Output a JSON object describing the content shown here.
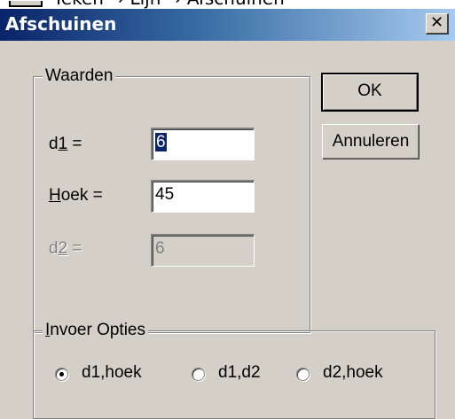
{
  "background_strip": {
    "text": "Teken → Lijn → Afschuinen"
  },
  "window": {
    "title": "Afschuinen",
    "close_glyph": "✕"
  },
  "waarden": {
    "legend": "Waarden",
    "d1": {
      "label_pre": "d",
      "label_mnemonic": "1",
      "label_post": " =",
      "value": "6"
    },
    "hoek": {
      "label_mnemonic": "H",
      "label_post": "oek =",
      "value": "45"
    },
    "d2": {
      "label_pre": "d",
      "label_mnemonic": "2",
      "label_post": " =",
      "value": "6"
    }
  },
  "buttons": {
    "ok": "OK",
    "cancel": "Annuleren"
  },
  "invoer": {
    "legend_mnemonic": "I",
    "legend_rest": "nvoer Opties",
    "options": [
      {
        "label": "d1,hoek",
        "selected": true
      },
      {
        "label": "d1,d2",
        "selected": false
      },
      {
        "label": "d2,hoek",
        "selected": false
      }
    ]
  },
  "colors": {
    "face": "#d4d0c8",
    "title_start": "#0a246a",
    "title_end": "#a6caf0",
    "selection": "#0a246a"
  }
}
